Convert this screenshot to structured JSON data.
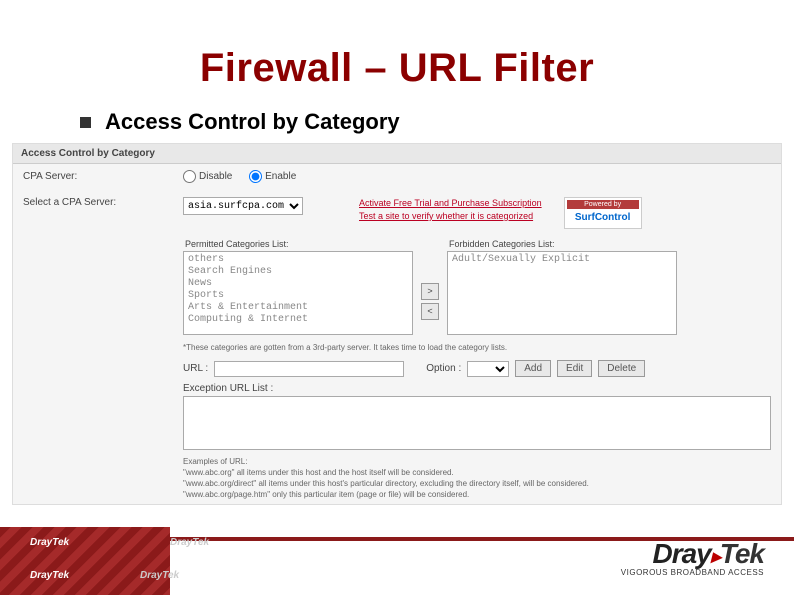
{
  "title": "Firewall – URL Filter",
  "bullet": "Access Control by Category",
  "panel": {
    "header": "Access Control by Category",
    "cpa_label": "CPA Server:",
    "disable": "Disable",
    "enable": "Enable",
    "select_label": "Select a CPA Server:",
    "server_value": "asia.surfcpa.com",
    "link1": "Activate Free Trial and Purchase Subscription",
    "link2": "Test a site to verify whether it is categorized",
    "powered": "Powered by",
    "provider": "SurfControl",
    "permitted_label": "Permitted Categories List:",
    "forbidden_label": "Forbidden Categories List:",
    "permitted_items": [
      "others",
      "Search Engines",
      "News",
      "Sports",
      "Arts & Entertainment",
      "Computing & Internet"
    ],
    "forbidden_items": [
      "Adult/Sexually Explicit"
    ],
    "arrow_right": ">",
    "arrow_left": "<",
    "note": "*These categories are gotten from a 3rd-party server. It takes time to load the category lists.",
    "url_label": "URL :",
    "option_label": "Option :",
    "btn_add": "Add",
    "btn_edit": "Edit",
    "btn_delete": "Delete",
    "exc_label": "Exception URL List :",
    "ex_title": "Examples of URL:",
    "ex1": "\"www.abc.org\" all items under this host and the host itself will be considered.",
    "ex2": "\"www.abc.org/direct\" all items under this host's particular directory, excluding the directory itself, will be considered.",
    "ex3": "\"www.abc.org/page.htm\" only this particular item (page or file) will be considered."
  },
  "footer": {
    "brand": "DrayTek",
    "tagline": "VIGOROUS BROADBAND ACCESS"
  }
}
